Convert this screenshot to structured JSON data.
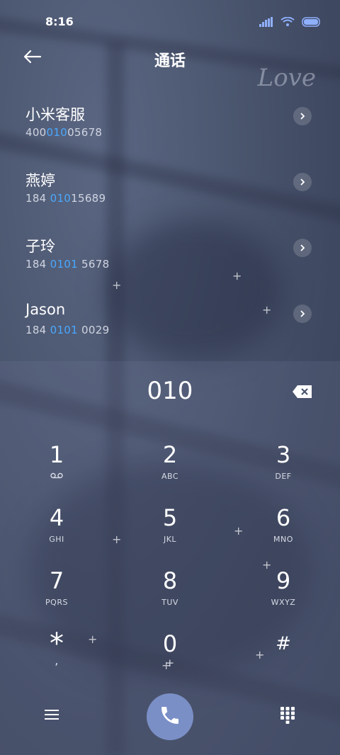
{
  "status_bar": {
    "time": "8:16"
  },
  "header": {
    "title": "通话",
    "back_icon": "arrow-left-icon",
    "decoration_text": "Love"
  },
  "contacts": [
    {
      "name": "小米客服",
      "number_pre": "400",
      "number_match": "010",
      "number_post": "05678"
    },
    {
      "name": "燕婷",
      "number_pre": "184 ",
      "number_match": "010",
      "number_post": "15689"
    },
    {
      "name": "子玲",
      "number_pre": "184 ",
      "number_match": "0101",
      "number_post": " 5678"
    },
    {
      "name": "Jason",
      "number_pre": "184 ",
      "number_match": "0101",
      "number_post": " 0029"
    }
  ],
  "dialer": {
    "input": "010"
  },
  "keys": [
    {
      "digit": "1",
      "letters": ""
    },
    {
      "digit": "2",
      "letters": "ABC"
    },
    {
      "digit": "3",
      "letters": "DEF"
    },
    {
      "digit": "4",
      "letters": "GHI"
    },
    {
      "digit": "5",
      "letters": "JKL"
    },
    {
      "digit": "6",
      "letters": "MNO"
    },
    {
      "digit": "7",
      "letters": "PQRS"
    },
    {
      "digit": "8",
      "letters": "TUV"
    },
    {
      "digit": "9",
      "letters": "WXYZ"
    },
    {
      "digit": "*",
      "letters": ","
    },
    {
      "digit": "0",
      "letters": "+"
    },
    {
      "digit": "#",
      "letters": ""
    }
  ],
  "colors": {
    "highlight": "#4aa8ff",
    "call_button": "#7b8fc7"
  }
}
